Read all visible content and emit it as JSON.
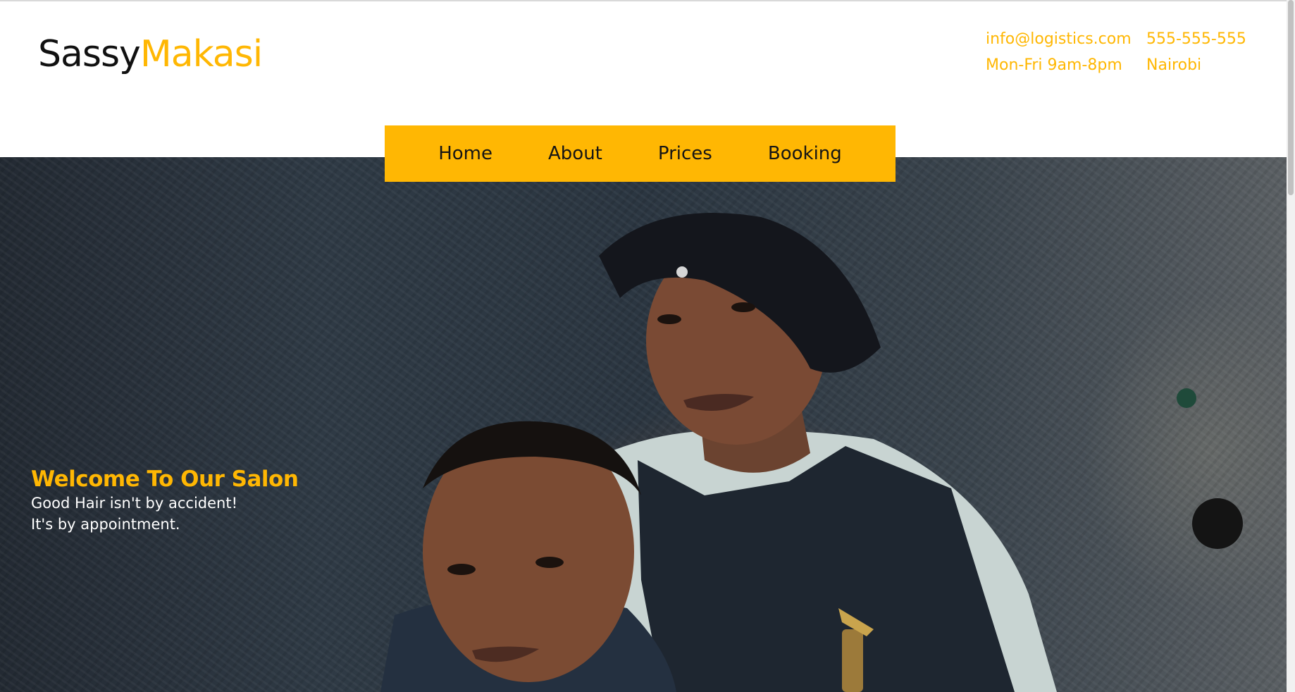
{
  "brand": {
    "name_part1": "Sassy",
    "name_part2": "Makasi",
    "accent_color": "#ffb703",
    "dark_color": "#111111"
  },
  "contact": {
    "email": "info@logistics.com",
    "phone": "555-555-555",
    "hours": "Mon-Fri 9am-8pm",
    "location": "Nairobi"
  },
  "nav": {
    "items": [
      {
        "label": "Home"
      },
      {
        "label": "About"
      },
      {
        "label": "Prices"
      },
      {
        "label": "Booking"
      }
    ],
    "background_color": "#ffb703"
  },
  "hero": {
    "title": "Welcome To Our Salon",
    "line1": "Good Hair isn't by accident!",
    "line2": "It's by appointment.",
    "image_description_icon": "photo-two-men-barbershop"
  }
}
